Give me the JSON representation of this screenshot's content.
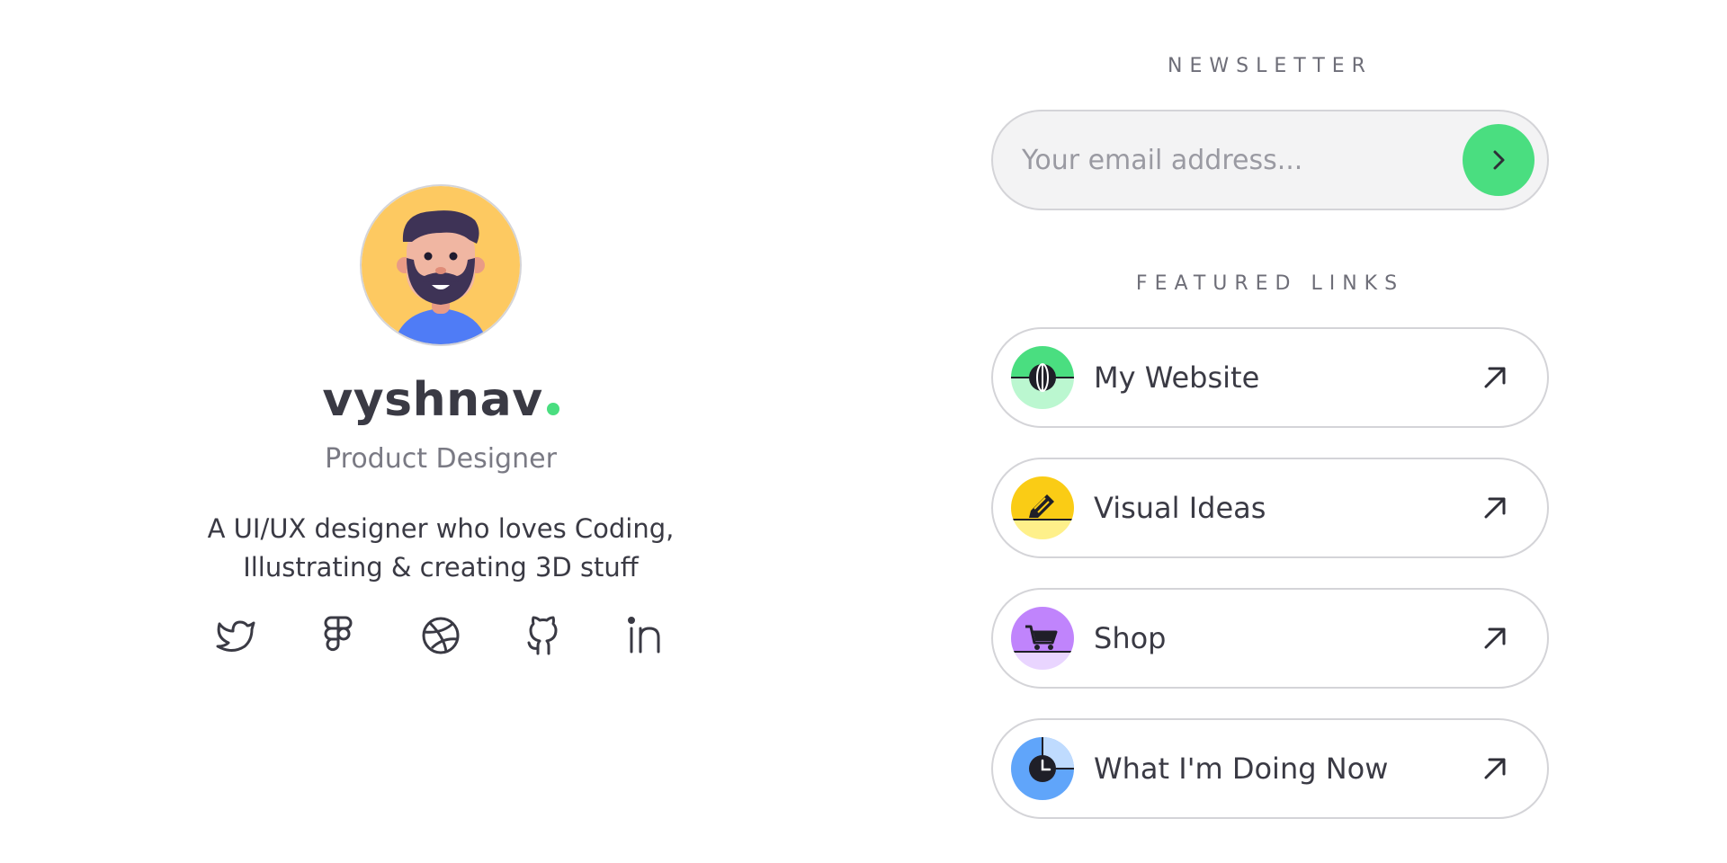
{
  "profile": {
    "name": "vyshnav",
    "role": "Product Designer",
    "bio_line1": "A UI/UX designer who loves Coding,",
    "bio_line2": "Illustrating & creating 3D stuff",
    "avatar": "avatar-illustration-bearded-man",
    "accent_color": "#4ade80",
    "socials": [
      {
        "name": "twitter",
        "icon": "twitter-icon"
      },
      {
        "name": "figma",
        "icon": "figma-icon"
      },
      {
        "name": "dribbble",
        "icon": "dribbble-icon"
      },
      {
        "name": "github",
        "icon": "github-icon"
      },
      {
        "name": "linkedin",
        "icon": "linkedin-icon"
      }
    ]
  },
  "newsletter": {
    "title": "NEWSLETTER",
    "placeholder": "Your email address...",
    "submit_icon": "chevron-right-icon",
    "submit_color": "#4ade80"
  },
  "featured": {
    "title": "FEATURED LINKS",
    "links": [
      {
        "label": "My Website",
        "icon": "globe-icon",
        "color": "#4ade80"
      },
      {
        "label": "Visual Ideas",
        "icon": "pencil-icon",
        "color": "#facc15"
      },
      {
        "label": "Shop",
        "icon": "cart-icon",
        "color": "#c084fc"
      },
      {
        "label": "What I'm Doing Now",
        "icon": "clock-icon",
        "color": "#60a5fa"
      }
    ],
    "arrow_icon": "arrow-up-right-icon"
  }
}
